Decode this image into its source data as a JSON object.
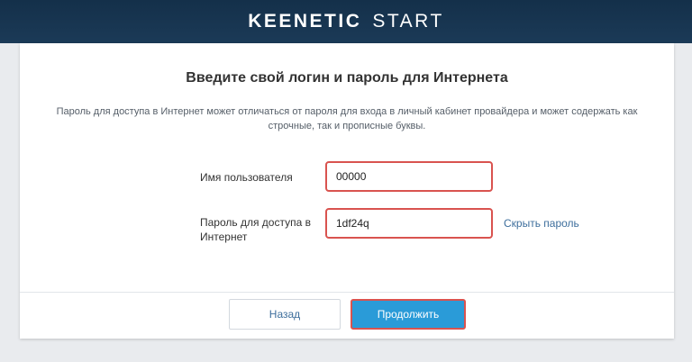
{
  "header": {
    "brand": "KEENETIC",
    "product": "START"
  },
  "form": {
    "title": "Введите свой логин и пароль для Интернета",
    "description": "Пароль для доступа в Интернет может отличаться от пароля для входа в личный кабинет провайдера и может содержать как строчные, так и прописные буквы.",
    "username": {
      "label": "Имя пользователя",
      "value": "00000"
    },
    "password": {
      "label": "Пароль для доступа в Интернет",
      "value": "1df24q",
      "toggle_label": "Скрыть пароль"
    }
  },
  "footer": {
    "back_label": "Назад",
    "next_label": "Продолжить"
  },
  "colors": {
    "header_bg": "#1b3a57",
    "primary_button": "#2a9bd8",
    "highlight_border": "#d9534f",
    "link": "#3d6e9c"
  }
}
